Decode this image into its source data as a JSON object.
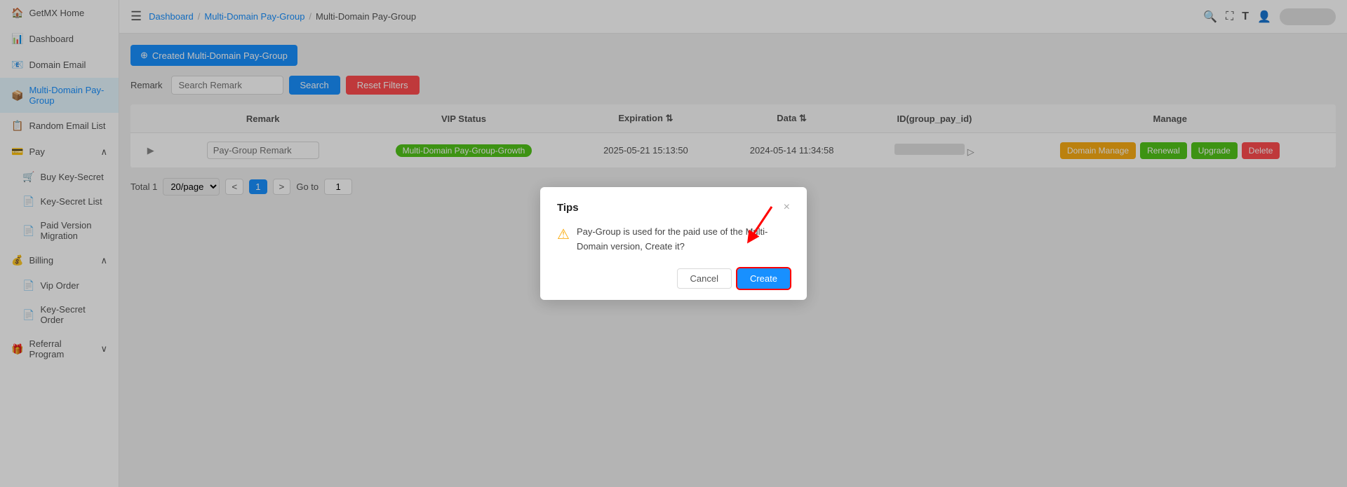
{
  "sidebar": {
    "logo": "GetMX Home",
    "items": [
      {
        "id": "getmx-home",
        "label": "GetMX Home",
        "icon": "🏠",
        "active": false
      },
      {
        "id": "dashboard",
        "label": "Dashboard",
        "icon": "📊",
        "active": false
      },
      {
        "id": "domain-email",
        "label": "Domain Email",
        "icon": "📧",
        "active": false
      },
      {
        "id": "multi-domain",
        "label": "Multi-Domain Pay-Group",
        "icon": "📦",
        "active": true
      },
      {
        "id": "random-email",
        "label": "Random Email List",
        "icon": "📋",
        "active": false
      }
    ],
    "pay_group": {
      "label": "Pay",
      "icon": "💳",
      "sub_items": [
        {
          "id": "buy-key-secret",
          "label": "Buy Key-Secret",
          "icon": "🛒"
        },
        {
          "id": "key-secret-list",
          "label": "Key-Secret List",
          "icon": "📄"
        },
        {
          "id": "paid-version-migration",
          "label": "Paid Version Migration",
          "icon": "📄"
        }
      ]
    },
    "billing_group": {
      "label": "Billing",
      "icon": "💰",
      "sub_items": [
        {
          "id": "vip-order",
          "label": "Vip Order",
          "icon": "📄"
        },
        {
          "id": "key-secret-order",
          "label": "Key-Secret Order",
          "icon": "📄"
        }
      ]
    },
    "referral_group": {
      "label": "Referral Program",
      "icon": "🎁"
    }
  },
  "header": {
    "hamburger": "☰",
    "breadcrumbs": [
      {
        "label": "Dashboard",
        "link": true
      },
      {
        "label": "Multi-Domain Pay-Group",
        "link": true
      },
      {
        "label": "Multi-Domain Pay-Group",
        "link": false
      }
    ],
    "icons": {
      "search": "🔍",
      "expand": "⛶",
      "font": "T",
      "user": "A"
    }
  },
  "content": {
    "created_button": "Created Multi-Domain Pay-Group",
    "filter": {
      "label": "Remark",
      "search_remark_placeholder": "Search Remark",
      "search_button": "Search",
      "reset_button": "Reset Filters"
    },
    "table": {
      "columns": [
        "Remark",
        "VIP Status",
        "Expiration",
        "Data",
        "ID(group_pay_id)",
        "Manage"
      ],
      "rows": [
        {
          "remark_placeholder": "Pay-Group Remark",
          "vip_status": "Multi-Domain Pay-Group-Growth",
          "expiration": "2025-05-21 15:13:50",
          "data": "2024-05-14 11:34:58",
          "id_bar": "",
          "manage": {
            "domain": "Domain Manage",
            "renewal": "Renewal",
            "upgrade": "Upgrade",
            "delete": "Delete"
          }
        }
      ]
    },
    "pagination": {
      "total_label": "Total 1",
      "page_size": "20/page",
      "prev": "<",
      "page": "1",
      "next": ">",
      "goto_label": "Go to",
      "goto_value": "1"
    }
  },
  "modal": {
    "title": "Tips",
    "close_icon": "×",
    "warning_icon": "⚠",
    "message": "Pay-Group is used for the paid use of the Multi-Domain version, Create it?",
    "cancel_button": "Cancel",
    "create_button": "Create"
  }
}
